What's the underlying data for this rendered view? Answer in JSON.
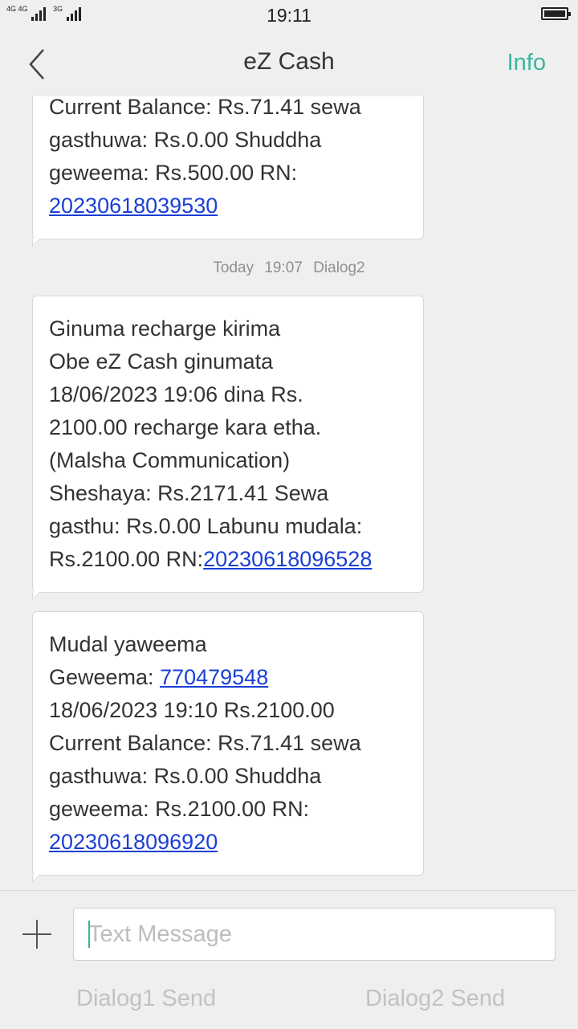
{
  "status": {
    "net1": "4G 4G",
    "net2": "3G",
    "time": "19:11"
  },
  "header": {
    "title": "eZ Cash",
    "info_label": "Info"
  },
  "messages": [
    {
      "lines": [
        "Current Balance: Rs.71.41 sewa",
        "gasthuwa: Rs.0.00 Shuddha",
        "geweema: Rs.500.00 RN:"
      ],
      "link": "20230618039530"
    },
    {
      "lines": [
        "Ginuma recharge kirima",
        "Obe eZ Cash ginumata",
        "18/06/2023 19:06 dina Rs.",
        "2100.00 recharge kara etha.",
        "(Malsha Communication)",
        "Sheshaya: Rs.2171.41 Sewa",
        "gasthu: Rs.0.00 Labunu mudala:"
      ],
      "last_prefix": "Rs.2100.00 RN:",
      "link": "20230618096528"
    },
    {
      "line1": "Mudal yaweema",
      "geweema_prefix": "Geweema: ",
      "geweema_link": "770479548",
      "lines": [
        "18/06/2023 19:10 Rs.2100.00",
        "Current Balance: Rs.71.41 sewa",
        "gasthuwa: Rs.0.00 Shuddha",
        "geweema: Rs.2100.00 RN:"
      ],
      "link": "20230618096920"
    }
  ],
  "timestamp": {
    "day": "Today",
    "time": "19:07",
    "sim": "Dialog2"
  },
  "composer": {
    "placeholder": "Text Message",
    "send1": "Dialog1 Send",
    "send2": "Dialog2 Send"
  },
  "colors": {
    "accent": "#3bb5a0",
    "link": "#1a3fd6"
  }
}
